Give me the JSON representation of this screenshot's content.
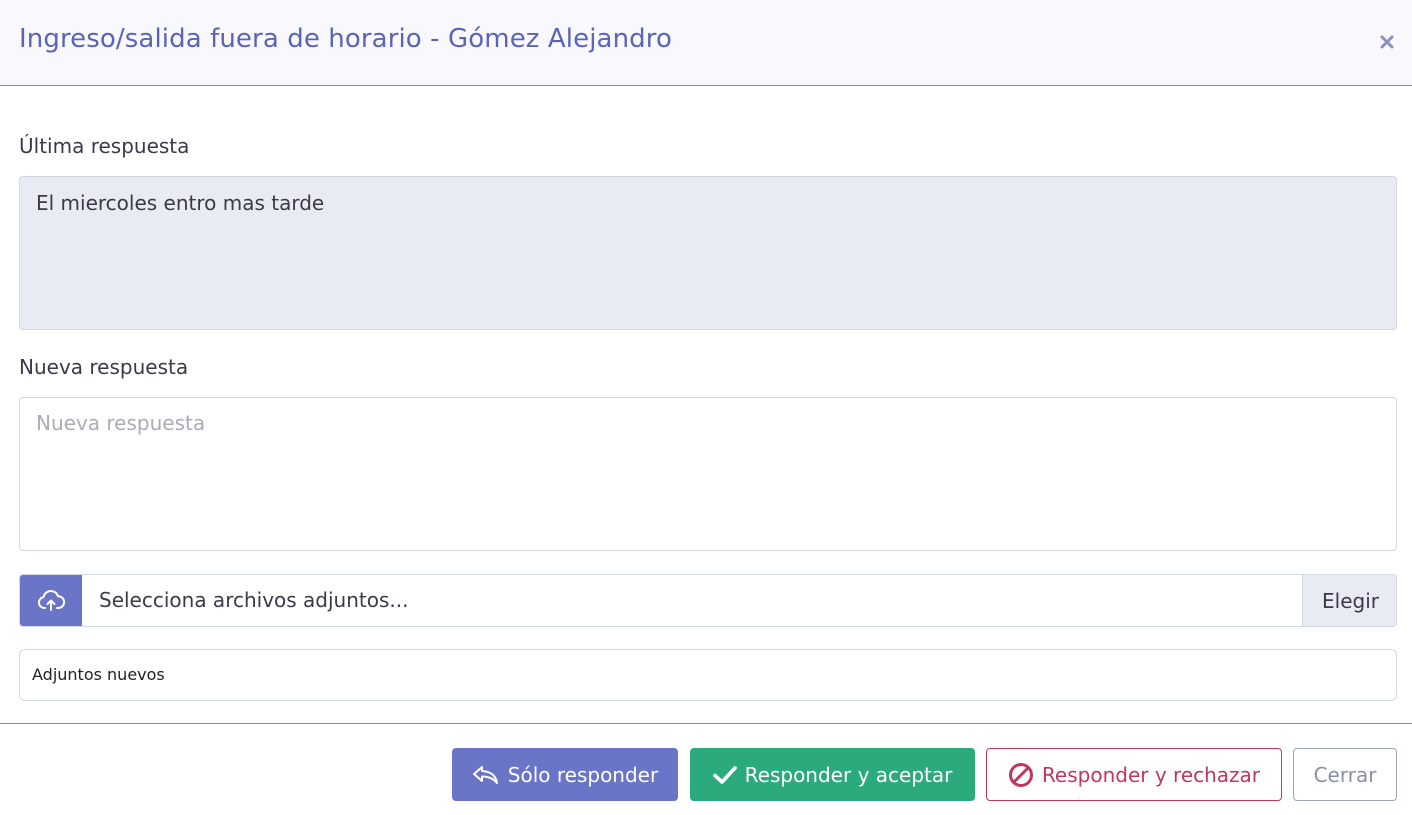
{
  "modal": {
    "title": "Ingreso/salida fuera de horario - Gómez Alejandro",
    "close_glyph": "×"
  },
  "last_reply": {
    "label": "Última respuesta",
    "text": "El miercoles entro mas tarde"
  },
  "new_reply": {
    "label": "Nueva respuesta",
    "placeholder": "Nueva respuesta",
    "value": ""
  },
  "file_upload": {
    "icon": "cloud-upload-icon",
    "placeholder": "Selecciona archivos adjuntos...",
    "choose_label": "Elegir"
  },
  "attachments": {
    "label": "Adjuntos nuevos"
  },
  "footer": {
    "reply_only_label": "Sólo responder",
    "reply_accept_label": "Responder y aceptar",
    "reply_reject_label": "Responder y rechazar",
    "close_label": "Cerrar"
  },
  "colors": {
    "primary": "#6a75c8",
    "success": "#2bab7b",
    "danger": "#c0375e",
    "title": "#5a64b8",
    "muted": "#8a8fa6"
  }
}
